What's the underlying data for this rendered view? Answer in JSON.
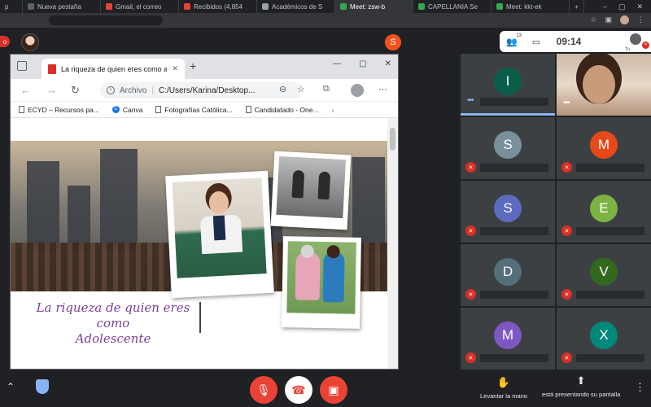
{
  "chrome": {
    "tabs": [
      {
        "label": "p",
        "fav": "#5f6368"
      },
      {
        "label": "Nueva pestaña",
        "fav": "#5f6368"
      },
      {
        "label": "Gmail, el correo",
        "fav": "#ea4335"
      },
      {
        "label": "Recibidos (4,854",
        "fav": "#ea4335"
      },
      {
        "label": "Académicos de S",
        "fav": "#9aa0a6"
      },
      {
        "label": "Meet: zsw-b",
        "fav": "#34a853",
        "active": true
      },
      {
        "label": "CAPELLANIA Se",
        "fav": "#34a853"
      },
      {
        "label": "Meet: kkt-ek",
        "fav": "#34a853"
      }
    ],
    "new_tab": "+"
  },
  "meet": {
    "red_badge": "o",
    "other_initial": "S",
    "people_count": "13",
    "clock": "09:14",
    "you_label": "Tú"
  },
  "edge": {
    "tab_title": "La riqueza de quien eres como a",
    "url_scheme": "Archivo",
    "url_path": "C:/Users/Karina/Desktop...",
    "bookmarks": [
      {
        "label": "ECYD – Recursos pa...",
        "icon": "doc"
      },
      {
        "label": "Canva",
        "icon": "canva"
      },
      {
        "label": "Fotografías Católica...",
        "icon": "doc"
      },
      {
        "label": "Candidatado - One...",
        "icon": "doc"
      }
    ]
  },
  "slide": {
    "title_line1": "La riqueza de quien eres como",
    "title_line2": "Adolescente"
  },
  "participants": [
    {
      "initial": "I",
      "color": "#0b5e4a",
      "muted": false,
      "speaking": true
    },
    {
      "initial": "",
      "color": "",
      "muted": false,
      "video": true
    },
    {
      "initial": "S",
      "color": "#78909c",
      "muted": true
    },
    {
      "initial": "M",
      "color": "#e64a19",
      "muted": true
    },
    {
      "initial": "S",
      "color": "#5c6bc0",
      "muted": true
    },
    {
      "initial": "E",
      "color": "#7cb342",
      "muted": true
    },
    {
      "initial": "D",
      "color": "#546e7a",
      "muted": true
    },
    {
      "initial": "V",
      "color": "#33691e",
      "muted": true
    },
    {
      "initial": "M",
      "color": "#7e57c2",
      "muted": true
    },
    {
      "initial": "X",
      "color": "#00897b",
      "muted": true
    }
  ],
  "controls": {
    "raise_hand": "Levantar la mano",
    "presenting": "está presentando su pantalla"
  }
}
